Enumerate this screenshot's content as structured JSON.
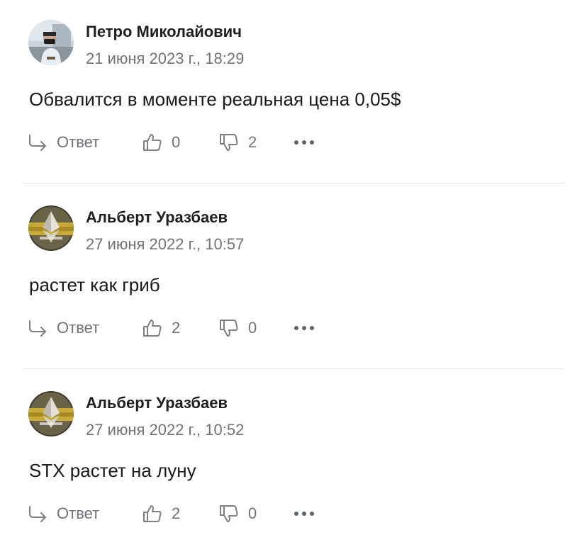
{
  "colors": {
    "text": "#1a1a1a",
    "muted": "#6e7378",
    "divider": "#e3e5e8",
    "icon": "#7b8087"
  },
  "icons": {
    "reply": "reply-arrow-icon",
    "like": "thumbs-up-icon",
    "dislike": "thumbs-down-icon",
    "more": "more-dots-icon"
  },
  "comments": [
    {
      "author": "Петро Миколайович",
      "date": "21 июня 2023 г., 18:29",
      "text": "Обвалится в моменте реальная цена 0,05$",
      "reply_label": "Ответ",
      "likes": "0",
      "dislikes": "2",
      "avatar": "user-photo"
    },
    {
      "author": "Альберт Уразбаев",
      "date": "27 июня 2022 г., 10:57",
      "text": "растет как гриб",
      "reply_label": "Ответ",
      "likes": "2",
      "dislikes": "0",
      "avatar": "ethereum-logo"
    },
    {
      "author": "Альберт Уразбаев",
      "date": "27 июня 2022 г., 10:52",
      "text": "STX растет на луну",
      "reply_label": "Ответ",
      "likes": "2",
      "dislikes": "0",
      "avatar": "ethereum-logo"
    }
  ]
}
